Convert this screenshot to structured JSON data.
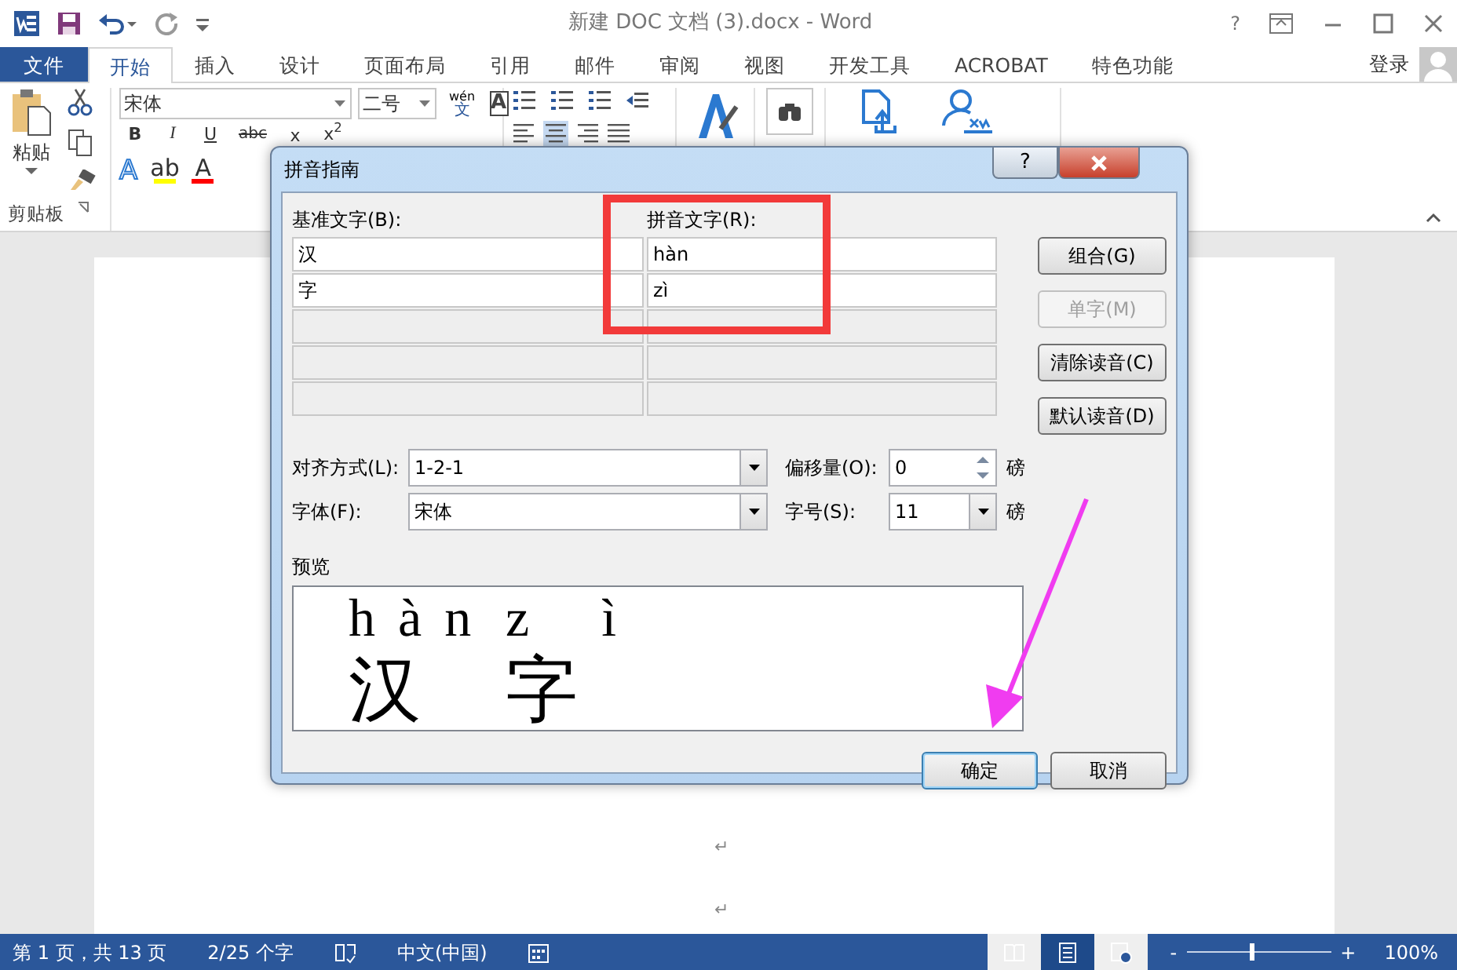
{
  "window": {
    "title": "新建 DOC 文档 (3).docx - Word",
    "help": "?"
  },
  "tabs": [
    {
      "label": "文件",
      "kind": "file",
      "selected": false
    },
    {
      "label": "开始",
      "kind": "tab",
      "selected": true
    },
    {
      "label": "插入",
      "kind": "tab",
      "selected": false
    },
    {
      "label": "设计",
      "kind": "tab",
      "selected": false
    },
    {
      "label": "页面布局",
      "kind": "tab",
      "selected": false
    },
    {
      "label": "引用",
      "kind": "tab",
      "selected": false
    },
    {
      "label": "邮件",
      "kind": "tab",
      "selected": false
    },
    {
      "label": "审阅",
      "kind": "tab",
      "selected": false
    },
    {
      "label": "视图",
      "kind": "tab",
      "selected": false
    },
    {
      "label": "开发工具",
      "kind": "tab",
      "selected": false
    },
    {
      "label": "ACROBAT",
      "kind": "tab",
      "selected": false
    },
    {
      "label": "特色功能",
      "kind": "tab",
      "selected": false
    }
  ],
  "account": {
    "label": "登录"
  },
  "ribbon": {
    "clipboard": {
      "paste": "粘贴",
      "group_label": "剪贴板"
    },
    "font": {
      "name": "宋体",
      "size": "二号",
      "phonetic_top": "wén",
      "phonetic_bottom": "文",
      "border_char": "A",
      "format_buttons": [
        {
          "label": "B",
          "kind": "bold"
        },
        {
          "label": "I",
          "kind": "italic"
        },
        {
          "label": "U",
          "kind": "underline"
        },
        {
          "label": "abc",
          "kind": "strike"
        },
        {
          "label": "x",
          "kind": "sub"
        },
        {
          "label": "x$^{2}$",
          "kind": "sup"
        }
      ],
      "effect_buttons": [
        {
          "label": "A",
          "kind": "outline"
        },
        {
          "label": "ab",
          "kind": "highlight",
          "color": "#ffff00"
        },
        {
          "label": "A",
          "kind": "fontcolor",
          "color": "#ff0000"
        }
      ]
    }
  },
  "document": {
    "paragraph_marks": [
      "↵",
      "↵"
    ]
  },
  "dialog": {
    "title": "拼音指南",
    "help": "?",
    "base_header": "基准文字(B):",
    "ruby_header": "拼音文字(R):",
    "rows": [
      {
        "base": "汉",
        "ruby": "hàn"
      },
      {
        "base": "字",
        "ruby": "zì"
      }
    ],
    "side_buttons": [
      {
        "label": "组合(G)",
        "disabled": false
      },
      {
        "label": "单字(M)",
        "disabled": true
      },
      {
        "label": "清除读音(C)",
        "disabled": false
      },
      {
        "label": "默认读音(D)",
        "disabled": false
      }
    ],
    "alignment": {
      "label": "对齐方式(L):",
      "value": "1-2-1"
    },
    "offset": {
      "label": "偏移量(O):",
      "value": "0",
      "unit": "磅"
    },
    "font": {
      "label": "字体(F):",
      "value": "宋体"
    },
    "size": {
      "label": "字号(S):",
      "value": "11",
      "unit": "磅"
    },
    "preview_label": "预览",
    "preview": [
      {
        "ruby": "hàn",
        "base": "汉"
      },
      {
        "ruby": "zì",
        "base": "字"
      }
    ],
    "buttons": [
      {
        "label": "确定",
        "default": true
      },
      {
        "label": "取消",
        "default": false
      }
    ]
  },
  "status_bar": {
    "items": [
      "第 1 页，共 13 页",
      "2/25 个字",
      "中文(中国)"
    ],
    "views": [
      {
        "kind": "read",
        "selected": false
      },
      {
        "kind": "print",
        "selected": true
      },
      {
        "kind": "web",
        "selected": false
      }
    ],
    "zoom": {
      "minus": "-",
      "plus": "+",
      "level": 0.45,
      "reading": "100%"
    }
  }
}
